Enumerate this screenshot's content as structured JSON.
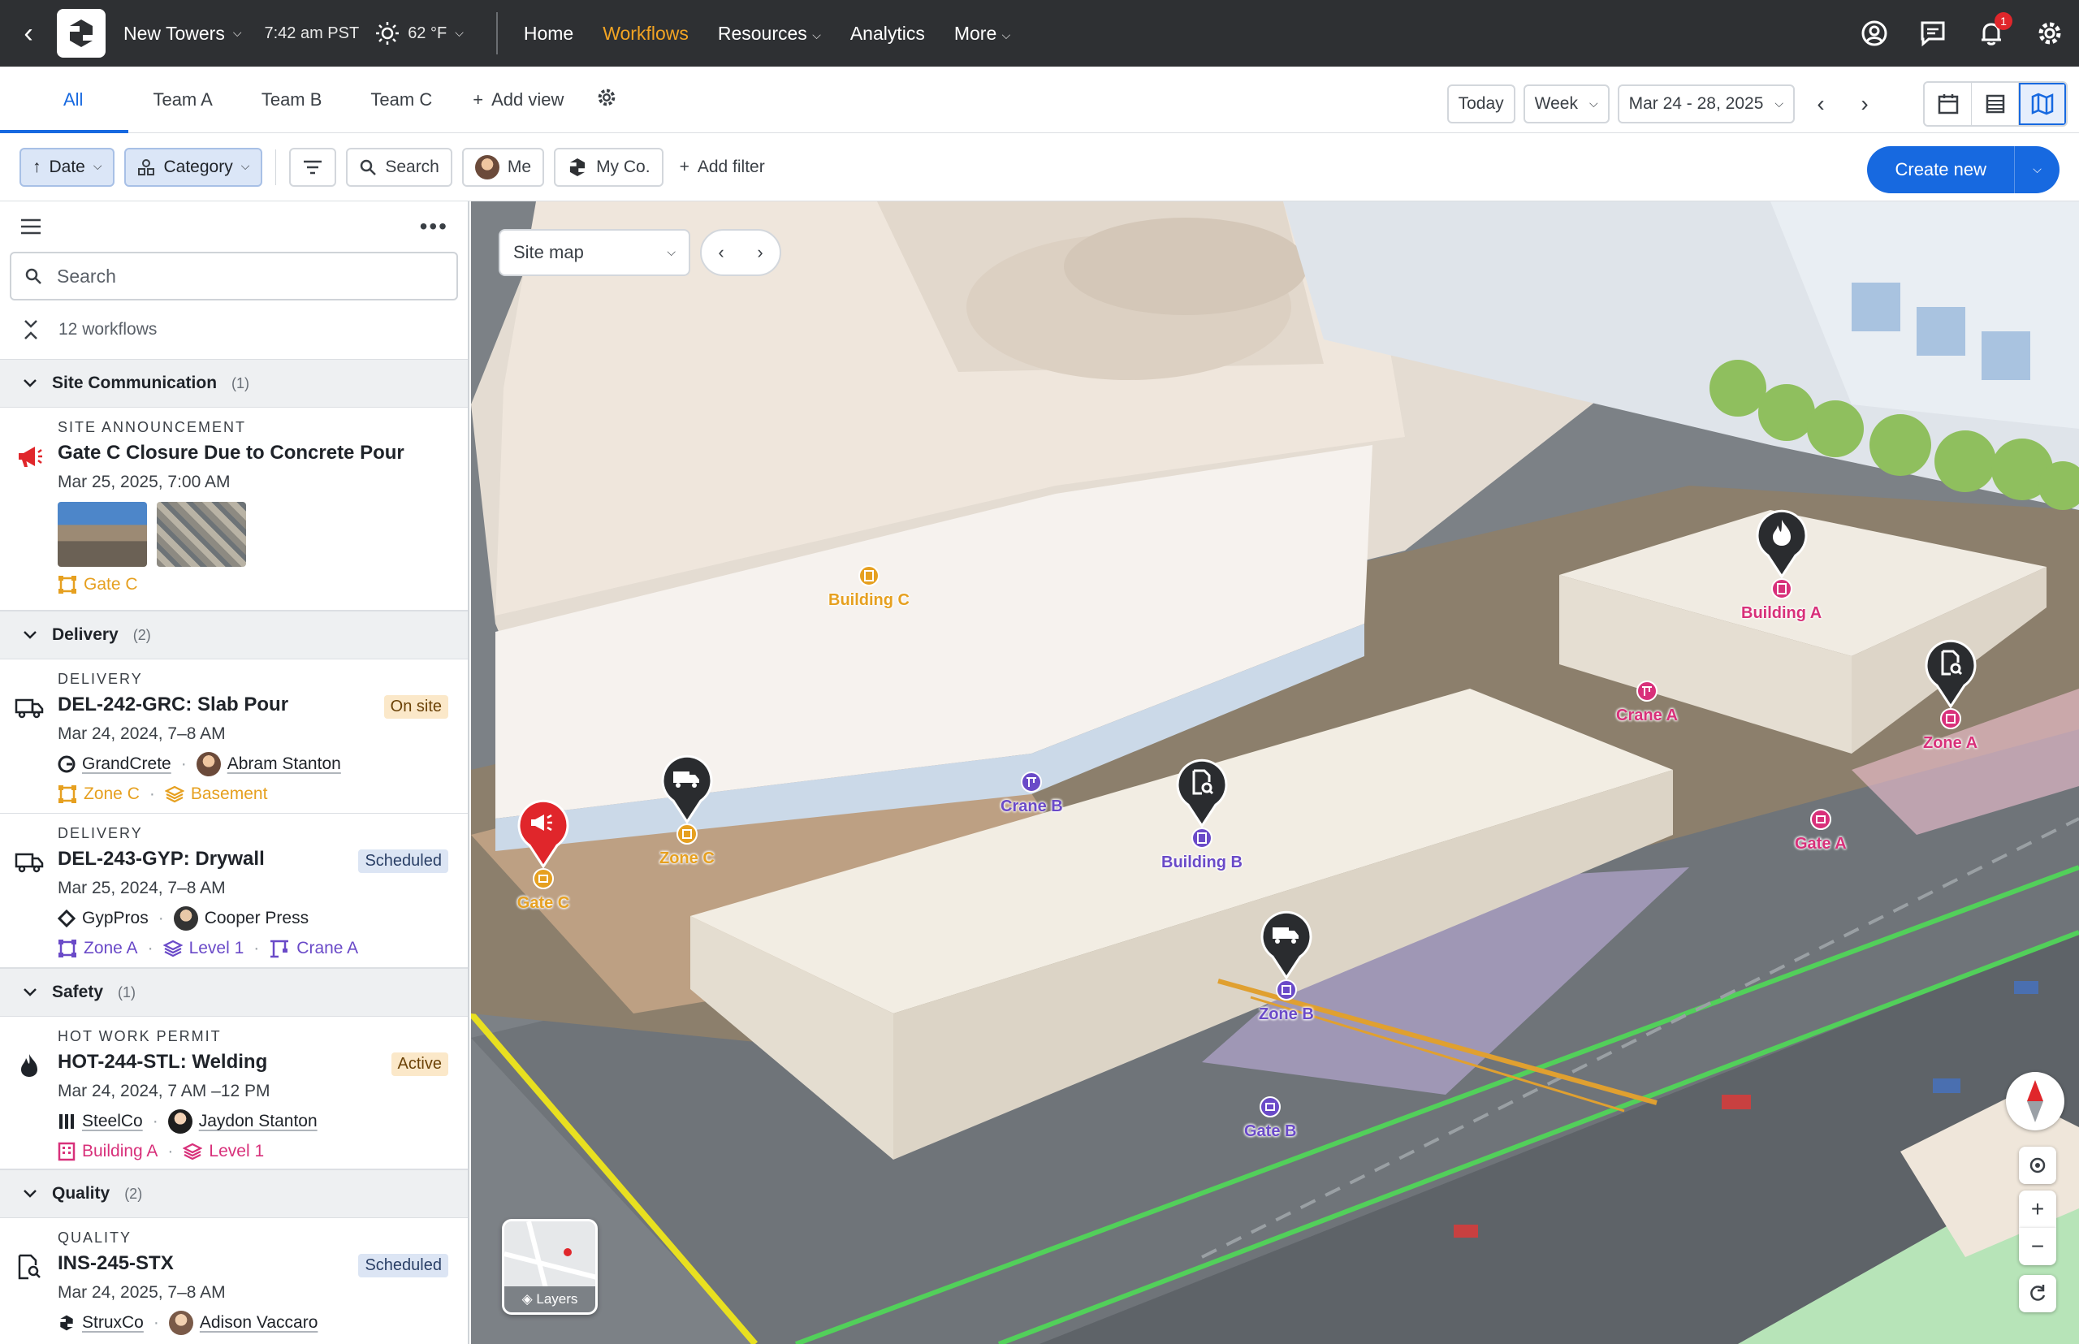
{
  "topbar": {
    "project": "New Towers",
    "time": "7:42 am PST",
    "temperature": "62 °F",
    "nav": [
      "Home",
      "Workflows",
      "Resources",
      "Analytics",
      "More"
    ],
    "active_nav": "Workflows",
    "notification_count": "1"
  },
  "views": {
    "tabs": [
      "All",
      "Team A",
      "Team B",
      "Team C"
    ],
    "add_view": "Add view",
    "today": "Today",
    "range": "Week",
    "date_range": "Mar 24 - 28, 2025"
  },
  "filters": {
    "date": "Date",
    "category": "Category",
    "search": "Search",
    "me": "Me",
    "company": "My Co.",
    "add_filter": "Add filter",
    "create_new": "Create new"
  },
  "sidebar": {
    "search_placeholder": "Search",
    "count": "12 workflows",
    "groups": [
      {
        "name": "Site Communication",
        "count": "(1)"
      },
      {
        "name": "Delivery",
        "count": "(2)"
      },
      {
        "name": "Safety",
        "count": "(1)"
      },
      {
        "name": "Quality",
        "count": "(2)"
      }
    ],
    "items": [
      {
        "kind": "SITE ANNOUNCEMENT",
        "title": "Gate C Closure Due to Concrete Pour",
        "date": "Mar 25, 2025, 7:00 AM",
        "loc1": "Gate C"
      },
      {
        "kind": "DELIVERY",
        "title": "DEL-242-GRC: Slab Pour",
        "status": "On site",
        "date": "Mar 24, 2024, 7–8 AM",
        "company": "GrandCrete",
        "person": "Abram Stanton",
        "loc1": "Zone C",
        "loc2": "Basement"
      },
      {
        "kind": "DELIVERY",
        "title": "DEL-243-GYP: Drywall",
        "status": "Scheduled",
        "date": "Mar 25, 2024, 7–8 AM",
        "company": "GypPros",
        "person": "Cooper Press",
        "loc1": "Zone A",
        "loc2": "Level 1",
        "loc3": "Crane A"
      },
      {
        "kind": "HOT WORK PERMIT",
        "title": "HOT-244-STL: Welding",
        "status": "Active",
        "date": "Mar 24, 2024, 7 AM –12 PM",
        "company": "SteelCo",
        "person": "Jaydon Stanton",
        "loc1": "Building A",
        "loc2": "Level 1"
      },
      {
        "kind": "QUALITY",
        "title": "INS-245-STX",
        "status": "Scheduled",
        "date": "Mar 24, 2025, 7–8 AM",
        "company": "StruxCo",
        "person": "Adison Vaccaro"
      }
    ]
  },
  "map": {
    "view": "Site map",
    "layers": "Layers",
    "labels": {
      "building_c": "Building C",
      "building_a": "Building A",
      "building_b": "Building B",
      "crane_a": "Crane A",
      "crane_b": "Crane B",
      "zone_a": "Zone A",
      "zone_b": "Zone B",
      "zone_c": "Zone C",
      "gate_a": "Gate A",
      "gate_b": "Gate B",
      "gate_c": "Gate C"
    },
    "colors": {
      "orange": "#e6a020",
      "pink": "#d8307a",
      "purple": "#6a4ac8",
      "red": "#e0262b",
      "dark": "#2a2c2f"
    }
  }
}
